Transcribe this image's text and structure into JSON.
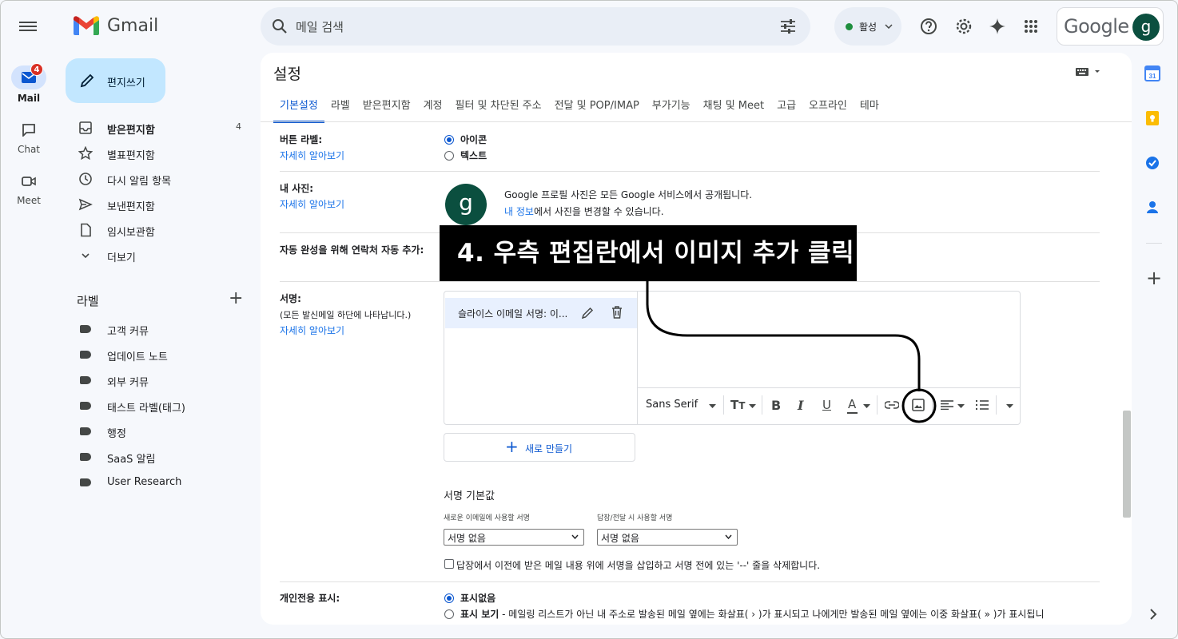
{
  "app": {
    "name": "Gmail",
    "brand": "Gmail"
  },
  "rail": {
    "mail": {
      "label": "Mail",
      "badge": "4"
    },
    "chat": {
      "label": "Chat"
    },
    "meet": {
      "label": "Meet"
    }
  },
  "search": {
    "placeholder": "메일 검색"
  },
  "status": {
    "label": "활성"
  },
  "account": {
    "wordmark": "Google",
    "initial": "g"
  },
  "compose": {
    "label": "편지쓰기"
  },
  "nav": [
    {
      "label": "받은편지함",
      "count": "4"
    },
    {
      "label": "별표편지함"
    },
    {
      "label": "다시 알림 항목"
    },
    {
      "label": "보낸편지함"
    },
    {
      "label": "임시보관함"
    },
    {
      "label": "더보기"
    }
  ],
  "labels": {
    "heading": "라벨",
    "items": [
      "고객 커뮤",
      "업데이트 노트",
      "외부 커뮤",
      "태스트 라벨(태그)",
      "행정",
      "SaaS 알림",
      "User Research"
    ]
  },
  "settings": {
    "title": "설정",
    "tabs": [
      "기본설정",
      "라벨",
      "받은편지함",
      "계정",
      "필터 및 차단된 주소",
      "전달 및 POP/IMAP",
      "부가기능",
      "채팅 및 Meet",
      "고급",
      "오프라인",
      "테마"
    ],
    "learn_more": "자세히 알아보기",
    "button_labels": {
      "label": "버튼 라벨:",
      "opt_icon": "아이콘",
      "opt_text": "텍스트"
    },
    "my_photo": {
      "label": "내 사진:",
      "line1": "Google 프로필 사진은 모든 Google 서비스에서 공개됩니다.",
      "link": "내 정보",
      "line2_rest": "에서 사진을 변경할 수 있습니다."
    },
    "autocomplete": {
      "label": "자동 완성을 위해 연락처 자동 추가:"
    },
    "signature": {
      "label": "서명:",
      "note": "(모든 발신메일 하단에 나타납니다.)",
      "item": "슬라이스 이메일 서명: 이...",
      "font": "Sans Serif",
      "new_button": "새로 만들기",
      "defaults_heading": "서명 기본값",
      "new_mail_label": "새로운 이메일에 사용할 서명",
      "reply_label": "답장/전달 시 사용할 서명",
      "new_mail_value": "서명 없음",
      "reply_value": "서명 없음",
      "checkbox": "답장에서 이전에 받은 메일 내용 위에 서명을 삽입하고 서명 전에 있는 '--' 줄을 삭제합니다."
    },
    "personal": {
      "label": "개인전용 표시:",
      "opt_none": "표시없음",
      "opt_show": "표시 보기",
      "opt_show_desc": " - 메일링 리스트가 아닌 내 주소로 발송된 메일 옆에는 화살표( › )가 표시되고 나에게만 발송된 메일 옆에는 이중 화살표( » )가 표시됩니"
    }
  },
  "annotation": {
    "text": "4. 우측 편집란에서 이미지 추가 클릭"
  },
  "colors": {
    "accent": "#0b57d0",
    "compose_bg": "#c2e7ff",
    "brand_green": "#0b4f3f"
  }
}
